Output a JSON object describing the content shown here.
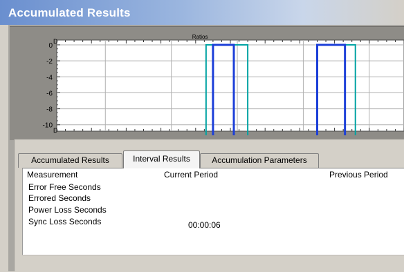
{
  "window": {
    "title": "Accumulated Results"
  },
  "chart_data": {
    "type": "line",
    "title": "Ratios",
    "yticks": [
      "0",
      "-2",
      "-4",
      "-6",
      "-8",
      "-10"
    ],
    "ylim": [
      -10.8,
      0.6
    ],
    "grid": true,
    "series": [
      {
        "color": "#00a3a3",
        "pulses": [
          {
            "start": 0.43,
            "end": 0.55,
            "value": 0
          },
          {
            "start": 0.75,
            "end": 0.86,
            "value": 0
          }
        ]
      },
      {
        "color": "#1c3fd8",
        "pulses": [
          {
            "start": 0.45,
            "end": 0.51,
            "value": 0
          },
          {
            "start": 0.75,
            "end": 0.83,
            "value": 0
          }
        ]
      }
    ]
  },
  "tabs": [
    {
      "label": "Accumulated Results",
      "active": false
    },
    {
      "label": "Interval Results",
      "active": true
    },
    {
      "label": "Accumulation Parameters",
      "active": false
    }
  ],
  "table": {
    "headers": {
      "measurement": "Measurement",
      "current": "Current Period",
      "previous": "Previous Period"
    },
    "rows": [
      {
        "measurement": "Error Free Seconds",
        "current": ""
      },
      {
        "measurement": "Errored Seconds",
        "current": ""
      },
      {
        "measurement": "Power Loss Seconds",
        "current": ""
      },
      {
        "measurement": "Sync Loss Seconds",
        "current": "00:00:06"
      }
    ]
  }
}
